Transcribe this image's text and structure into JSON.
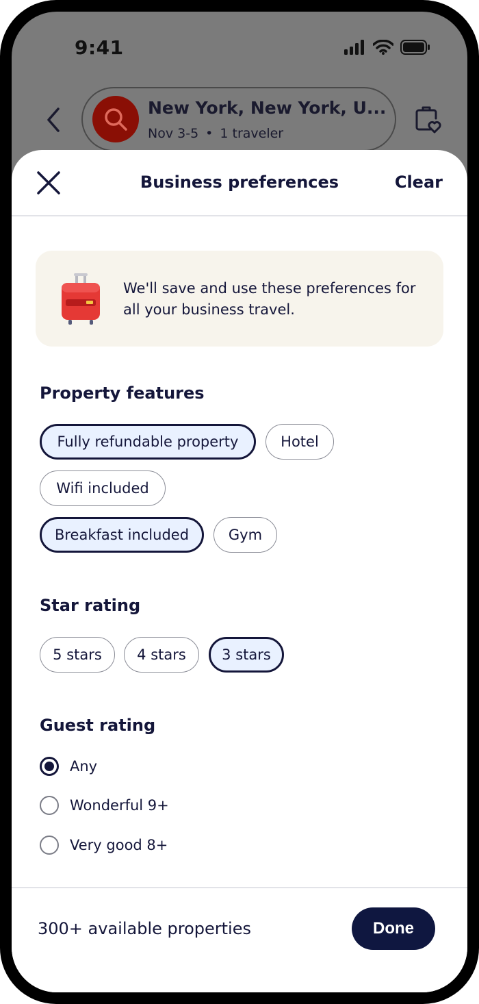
{
  "status_bar": {
    "time": "9:41"
  },
  "search": {
    "destination": "New York, New York, U...",
    "dates": "Nov 3-5",
    "separator": "•",
    "travelers": "1 traveler"
  },
  "sheet": {
    "title": "Business preferences",
    "clear_label": "Clear",
    "info_text": "We'll save and use these preferences for all your business travel."
  },
  "property_features": {
    "title": "Property features",
    "chips": [
      {
        "label": "Fully refundable property",
        "selected": true
      },
      {
        "label": "Hotel",
        "selected": false
      },
      {
        "label": "Wifi included",
        "selected": false
      },
      {
        "label": "Breakfast included",
        "selected": true
      },
      {
        "label": "Gym",
        "selected": false
      }
    ]
  },
  "star_rating": {
    "title": "Star rating",
    "chips": [
      {
        "label": "5 stars",
        "selected": false
      },
      {
        "label": "4 stars",
        "selected": false
      },
      {
        "label": "3 stars",
        "selected": true
      }
    ]
  },
  "guest_rating": {
    "title": "Guest rating",
    "options": [
      {
        "label": "Any",
        "selected": true
      },
      {
        "label": "Wonderful 9+",
        "selected": false
      },
      {
        "label": "Very good 8+",
        "selected": false
      }
    ]
  },
  "footer": {
    "results_text": "300+ available properties",
    "done_label": "Done"
  },
  "colors": {
    "primary_dark": "#14163a",
    "done_button": "#0f1740",
    "selected_chip_bg": "#e9f1ff",
    "info_card_bg": "#f7f4ec",
    "search_accent": "#8a0f05"
  },
  "icons": [
    "signal-icon",
    "wifi-icon",
    "battery-icon",
    "back-arrow-icon",
    "search-icon",
    "trip-heart-icon",
    "close-icon",
    "suitcase-icon"
  ]
}
